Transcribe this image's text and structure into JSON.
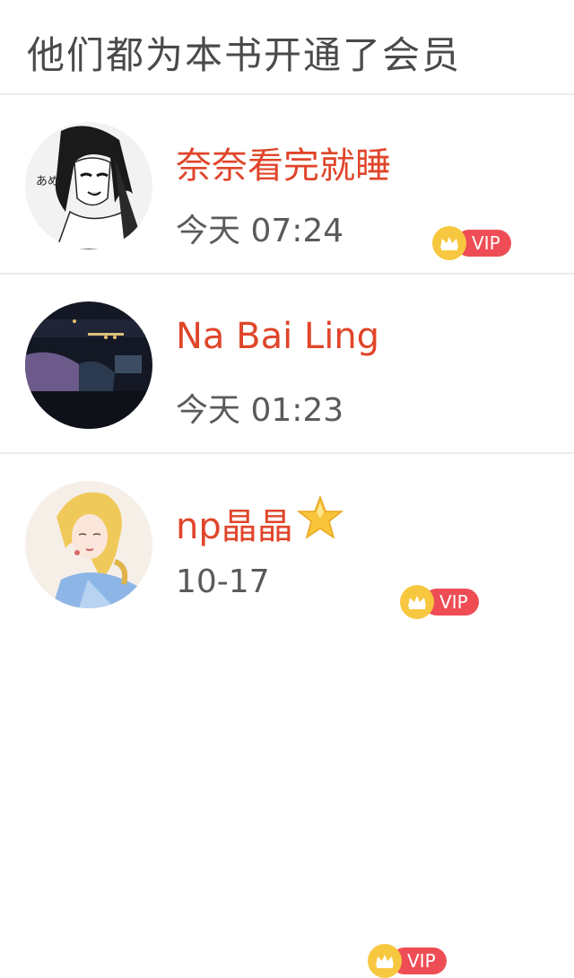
{
  "header": {
    "title": "他们都为本书开通了会员"
  },
  "badge": {
    "label": "VIP"
  },
  "members": [
    {
      "name": "奈奈看完就睡",
      "time": "今天 07:24"
    },
    {
      "name": "Na Bai Ling",
      "time": "今天 01:23"
    },
    {
      "name": "np晶晶",
      "time": "10-17",
      "emoji": "star-emoji"
    }
  ],
  "colors": {
    "name": "#e0452a",
    "vip_pill": "#ef4d55",
    "crown": "#f7c73f",
    "time": "#5a5a5a",
    "title": "#4a4a4a"
  }
}
